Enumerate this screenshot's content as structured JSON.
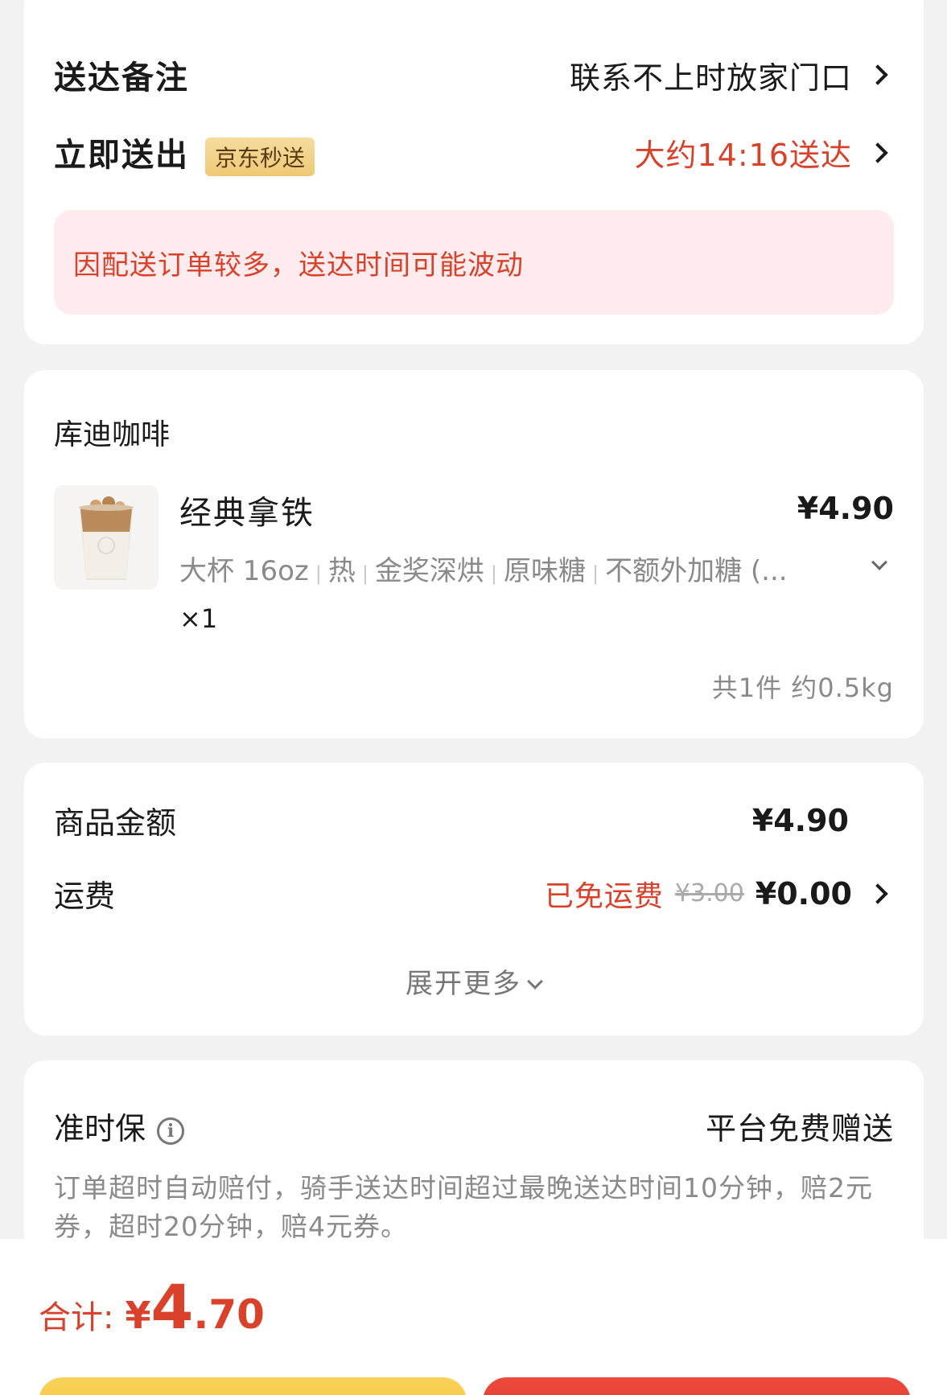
{
  "delivery": {
    "note_label": "送达备注",
    "note_value": "联系不上时放家门口",
    "send_label": "立即送出",
    "badge": "京东秒送",
    "eta": "大约14:16送达",
    "notice": "因配送订单较多，送达时间可能波动"
  },
  "shop": {
    "name": "库迪咖啡",
    "item": {
      "name": "经典拿铁",
      "price": "¥4.90",
      "specs": [
        "大杯 16oz",
        "热",
        "金奖深烘",
        "原味糖",
        "不额外加糖 (..."
      ],
      "qty": "×1"
    },
    "summary": "共1件 约0.5kg"
  },
  "fees": {
    "goods_label": "商品金额",
    "goods_value": "¥4.90",
    "shipping_label": "运费",
    "shipping_free": "已免运费",
    "shipping_original": "¥3.00",
    "shipping_value": "¥0.00",
    "expand": "展开更多"
  },
  "ontime": {
    "label": "准时保",
    "info_glyph": "i",
    "value": "平台免费赠送",
    "desc": "订单超时自动赔付，骑手送达时间超过最晚送达时间10分钟，赔2元券，超时20分钟，赔4元券。"
  },
  "footer": {
    "total_label": "合计:",
    "total_yen": "¥",
    "total_int": "4",
    "total_dec": ".70"
  },
  "colors": {
    "accent_red": "#d9412b",
    "badge_gold": "#eec874",
    "notice_bg": "#fdebed",
    "button_yellow": "#f5c23a",
    "button_red": "#e23b30"
  },
  "icons": [
    "chevron-right-icon",
    "chevron-down-icon",
    "info-icon"
  ]
}
